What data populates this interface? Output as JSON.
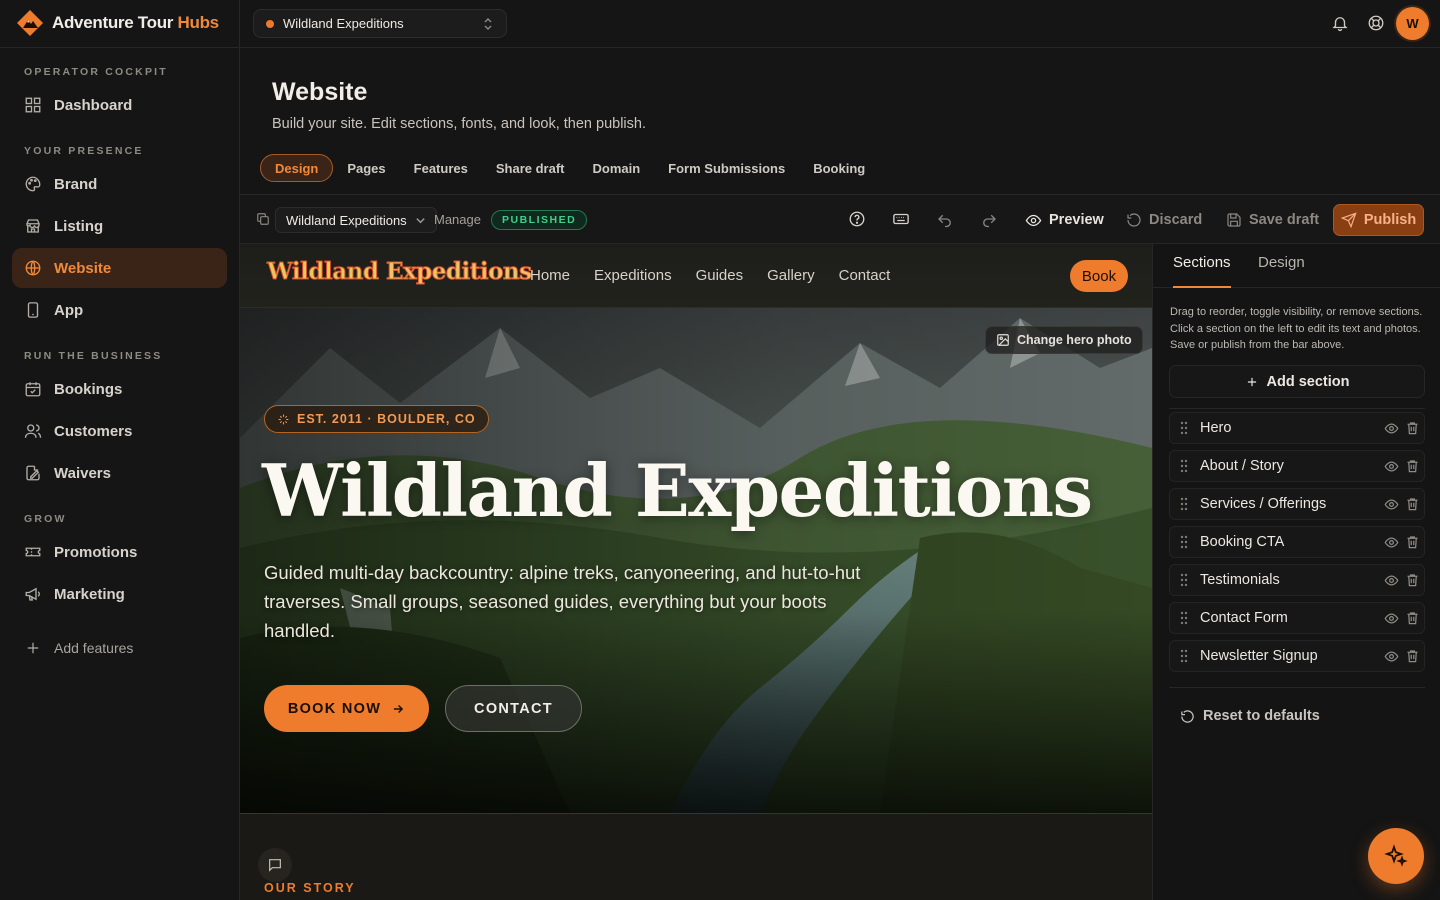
{
  "app": {
    "brand_part1": "Adventure Tour ",
    "brand_part2": "Hubs"
  },
  "site_switcher": {
    "selected": "Wildland Expeditions"
  },
  "topbar": {
    "avatar_initial": "W"
  },
  "sidebar": {
    "sections": [
      {
        "heading": "OPERATOR COCKPIT",
        "items": [
          {
            "label": "Dashboard",
            "icon": "grid-icon"
          }
        ]
      },
      {
        "heading": "YOUR PRESENCE",
        "items": [
          {
            "label": "Brand",
            "icon": "palette-icon"
          },
          {
            "label": "Listing",
            "icon": "store-icon"
          },
          {
            "label": "Website",
            "icon": "globe-icon",
            "active": true
          },
          {
            "label": "App",
            "icon": "phone-icon"
          }
        ]
      },
      {
        "heading": "RUN THE BUSINESS",
        "items": [
          {
            "label": "Bookings",
            "icon": "calendar-icon"
          },
          {
            "label": "Customers",
            "icon": "users-icon"
          },
          {
            "label": "Waivers",
            "icon": "document-signature-icon"
          }
        ]
      },
      {
        "heading": "GROW",
        "items": [
          {
            "label": "Promotions",
            "icon": "ticket-icon"
          },
          {
            "label": "Marketing",
            "icon": "megaphone-icon"
          }
        ]
      }
    ],
    "add_features": "Add features"
  },
  "page": {
    "title": "Website",
    "subtitle": "Build your site. Edit sections, fonts, and look, then publish.",
    "tabs": [
      "Design",
      "Pages",
      "Features",
      "Share draft",
      "Domain",
      "Form Submissions",
      "Booking"
    ],
    "active_tab": "Design"
  },
  "toolbar": {
    "site": "Wildland Expeditions",
    "manage": "Manage",
    "status": "PUBLISHED",
    "preview": "Preview",
    "discard": "Discard",
    "save_draft": "Save draft",
    "publish": "Publish"
  },
  "preview_site": {
    "logo_part1": "Wildland ",
    "logo_part2": "Expeditions",
    "nav_links": [
      "Home",
      "Expeditions",
      "Guides",
      "Gallery",
      "Contact"
    ],
    "book": "Book",
    "change_photo": "Change hero photo",
    "badge": "EST. 2011 · BOULDER, CO",
    "hero_title": "Wildland Expeditions",
    "hero_desc": "Guided multi-day backcountry: alpine treks, canyoneering, and hut-to-hut traverses. Small groups, seasoned guides, everything but your boots handled.",
    "cta_primary": "BOOK NOW",
    "cta_secondary": "CONTACT",
    "story_label": "OUR STORY"
  },
  "panel": {
    "tabs": [
      "Sections",
      "Design"
    ],
    "active_tab": "Sections",
    "hint": "Drag to reorder, toggle visibility, or remove sections. Click a section on the left to edit its text and photos. Save or publish from the bar above.",
    "add_section": "Add section",
    "sections": [
      "Hero",
      "About / Story",
      "Services / Offerings",
      "Booking CTA",
      "Testimonials",
      "Contact Form",
      "Newsletter Signup"
    ],
    "reset": "Reset to defaults"
  },
  "colors": {
    "accent": "#ef7b2c",
    "published": "#3fcf88",
    "background": "#131313"
  }
}
